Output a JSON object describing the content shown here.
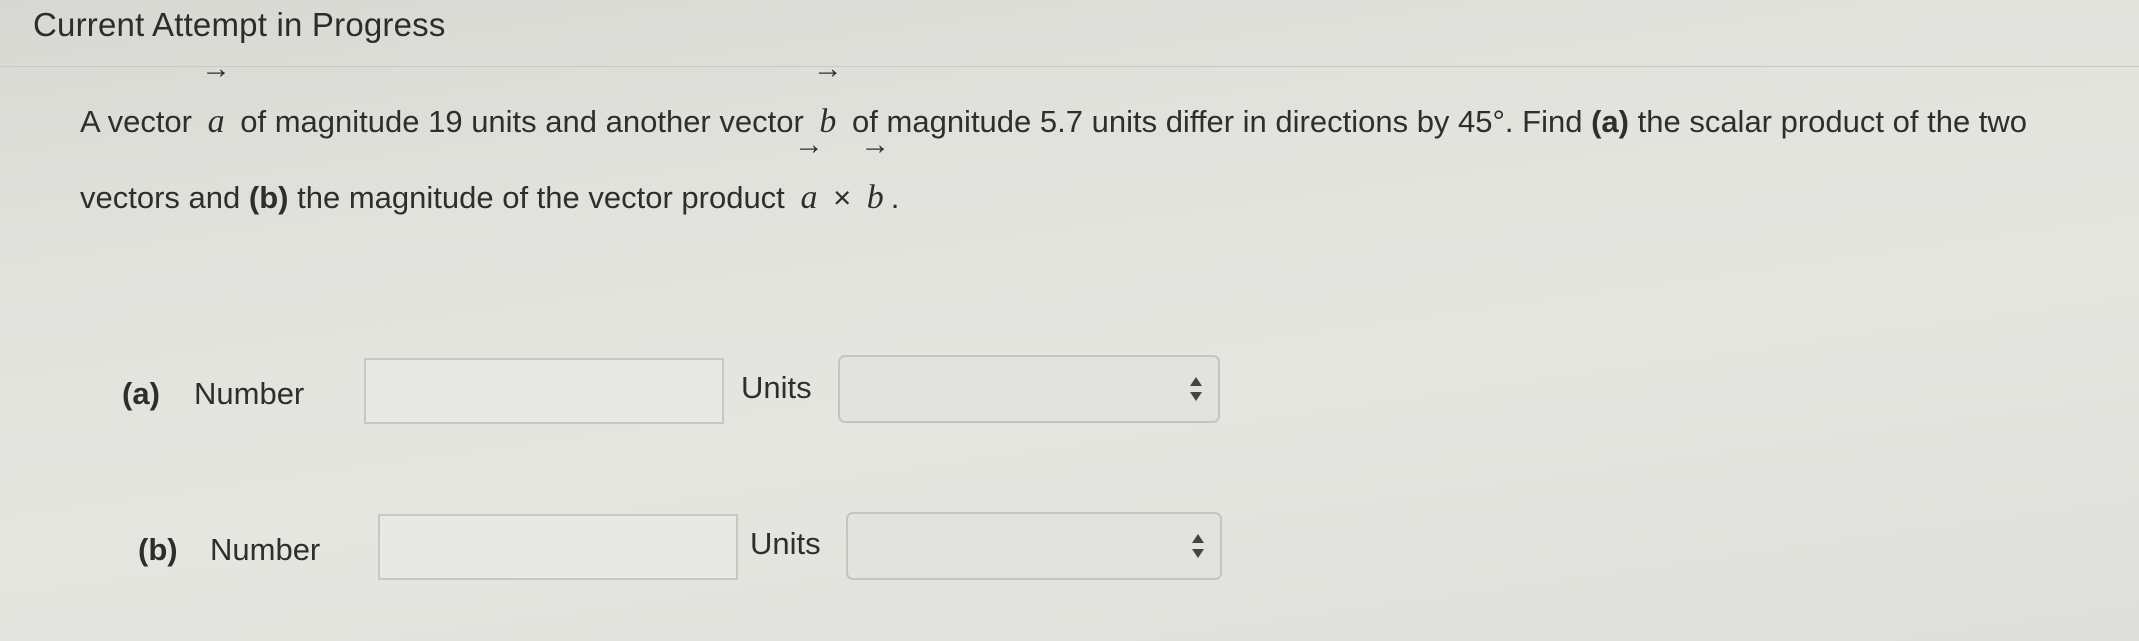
{
  "header": {
    "title": "Current Attempt in Progress"
  },
  "question": {
    "t1": "A vector",
    "vec_a": "a",
    "t2": "of magnitude 19 units and another vector",
    "vec_b": "b",
    "t3": "of magnitude 5.7 units differ in directions by 45°. Find",
    "bold_a": "(a)",
    "t4": "the scalar product of the two vectors and",
    "bold_b": "(b)",
    "t5": "the magnitude of the vector product",
    "cross": "×",
    "end": "."
  },
  "parts": [
    {
      "label": "(a)",
      "number_label": "Number",
      "number_value": "",
      "units_label": "Units",
      "units_value": ""
    },
    {
      "label": "(b)",
      "number_label": "Number",
      "number_value": "",
      "units_label": "Units",
      "units_value": ""
    }
  ],
  "icons": {
    "select_arrows": "up-down-arrows-icon"
  }
}
